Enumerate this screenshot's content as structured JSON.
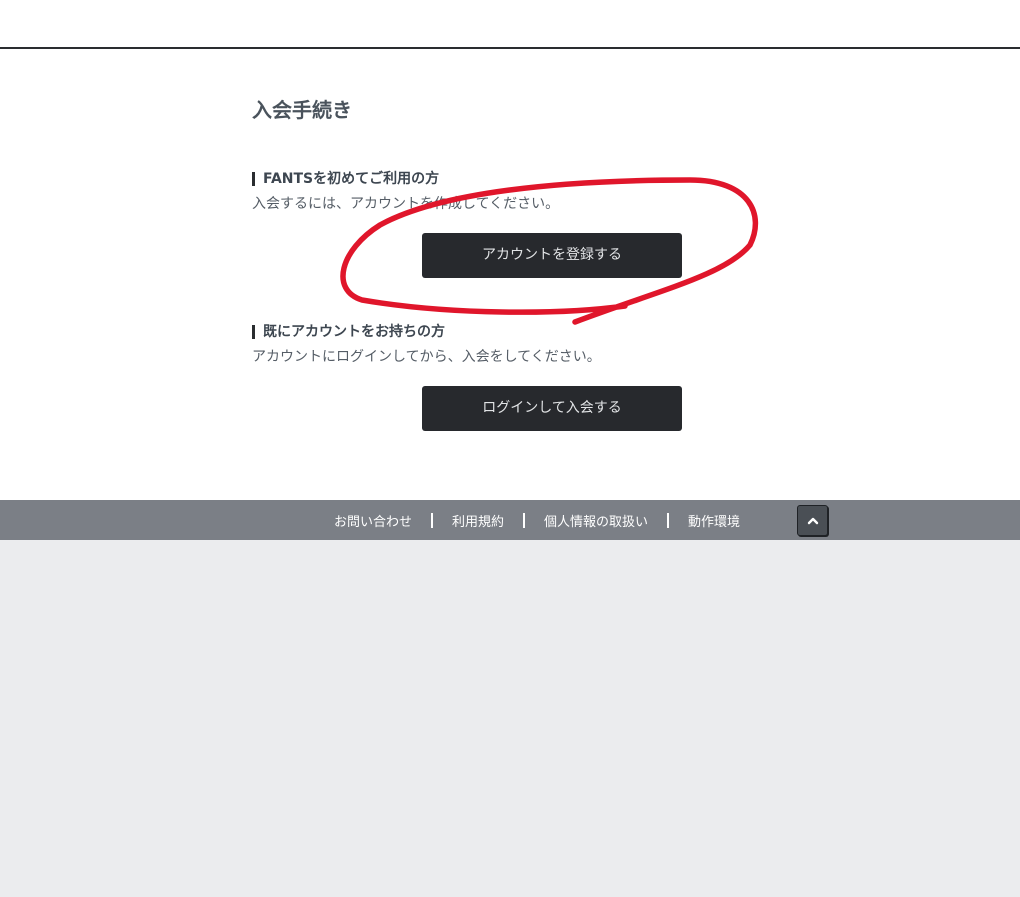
{
  "page": {
    "title": "入会手続き"
  },
  "sections": {
    "new_user": {
      "heading": "FANTSを初めてご利用の方",
      "description": "入会するには、アカウントを作成してください。",
      "button_label": "アカウントを登録する"
    },
    "existing_user": {
      "heading": "既にアカウントをお持ちの方",
      "description": "アカウントにログインしてから、入会をしてください。",
      "button_label": "ログインして入会する"
    }
  },
  "footer": {
    "links": [
      "お問い合わせ",
      "利用規約",
      "個人情報の取扱い",
      "動作環境"
    ],
    "top_button_icon": "chevron-up-icon"
  },
  "colors": {
    "button_bg": "#27292d",
    "footer_bg": "#7b7f86",
    "annotation_stroke": "#e0162b",
    "page_bg": "#ebecee"
  }
}
